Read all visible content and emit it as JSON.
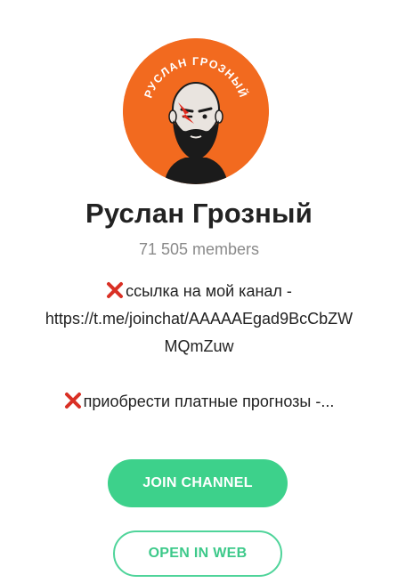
{
  "channel": {
    "avatar_text": "РУСЛАН ГРОЗНЫЙ",
    "name": "Руслан Грозный",
    "members": "71 505 members",
    "description": {
      "line1": "ссылка на мой канал -",
      "line2": "https://t.me/joinchat/AAAAAEgad9BcCbZW",
      "line3": "MQmZuw",
      "line4": "приобрести платные прогнозы -..."
    }
  },
  "icons": {
    "bullet": "cross-mark-icon"
  },
  "buttons": {
    "join_label": "JOIN CHANNEL",
    "web_label": "OPEN IN WEB"
  },
  "colors": {
    "avatar_bg": "#f26a1f",
    "join_bg": "#3dd18b",
    "web_border": "#4fd49a",
    "accent_text": "#3dc98a"
  }
}
